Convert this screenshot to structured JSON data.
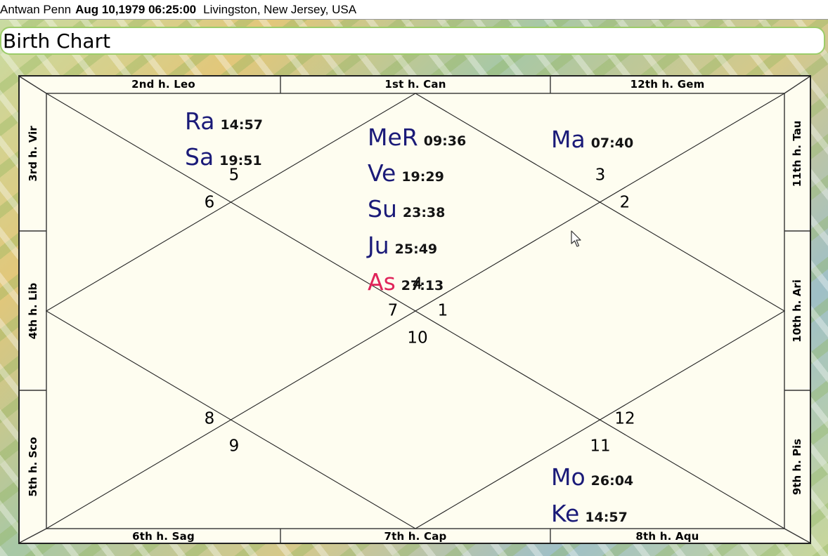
{
  "header": {
    "name": "Antwan Penn",
    "datetime": "Aug 10,1979 06:25:00",
    "place": "Livingston, New Jersey, USA"
  },
  "window": {
    "title": "Birth Chart"
  },
  "chart": {
    "top_cells": [
      "2nd h.  Leo",
      "1st h.  Can",
      "12th h.  Gem"
    ],
    "bottom_cells": [
      "6th h.  Sag",
      "7th h.  Cap",
      "8th h.  Aqu"
    ],
    "left_cells": [
      "3rd h.  Vir",
      "4th h.  Lib",
      "5th h.  Sco"
    ],
    "right_cells": [
      "11th h.  Tau",
      "10th h.  Ari",
      "9th h.  Pis"
    ],
    "house_numbers": [
      "1",
      "2",
      "3",
      "4",
      "5",
      "6",
      "7",
      "8",
      "9",
      "10",
      "11",
      "12"
    ],
    "planets": [
      {
        "abbr": "Ra",
        "degree": "14:57"
      },
      {
        "abbr": "Sa",
        "degree": "19:51"
      },
      {
        "abbr": "MeR",
        "degree": "09:36"
      },
      {
        "abbr": "Ve",
        "degree": "19:29"
      },
      {
        "abbr": "Su",
        "degree": "23:38"
      },
      {
        "abbr": "Ju",
        "degree": "25:49"
      },
      {
        "abbr": "As",
        "degree": "27:13"
      },
      {
        "abbr": "Ma",
        "degree": "07:40"
      },
      {
        "abbr": "Mo",
        "degree": "26:04"
      },
      {
        "abbr": "Ke",
        "degree": "14:57"
      }
    ],
    "colors": {
      "planet": "#1a1a78",
      "ascendant": "#e0245a",
      "chart_bg": "#fefdf0"
    }
  },
  "icons": {
    "cursor": "mouse-pointer-icon"
  }
}
